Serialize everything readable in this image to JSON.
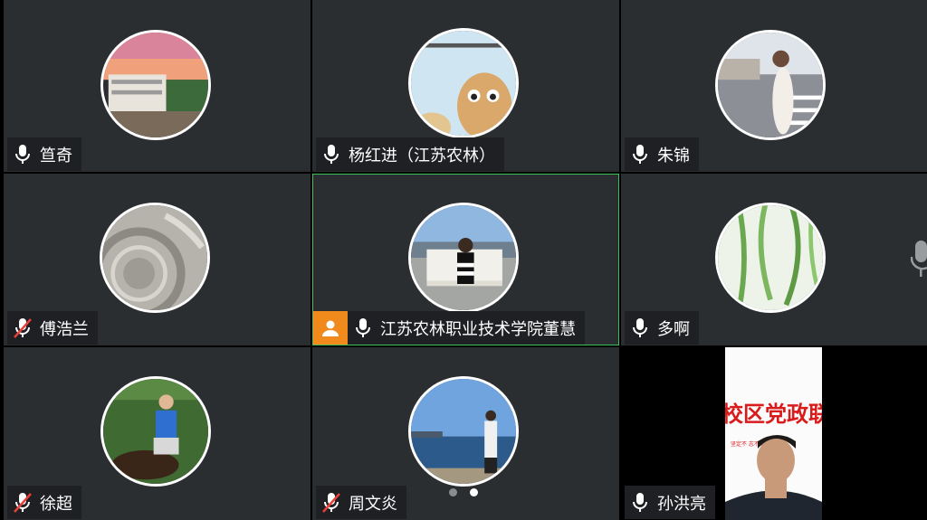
{
  "participants": [
    {
      "name": "笪奇",
      "mic": "on"
    },
    {
      "name": "杨红进（江苏农林）",
      "mic": "on"
    },
    {
      "name": "朱锦",
      "mic": "on"
    },
    {
      "name": "傅浩兰",
      "mic": "muted"
    },
    {
      "name": "江苏农林职业技术学院董慧",
      "mic": "on",
      "host": true,
      "active_speaker": true
    },
    {
      "name": "多啊",
      "mic": "on"
    },
    {
      "name": "徐超",
      "mic": "muted"
    },
    {
      "name": "周文炎",
      "mic": "muted"
    },
    {
      "name": "孙洪亮",
      "mic": "on",
      "video": true
    }
  ],
  "video_banner": {
    "headline": "校区党政联",
    "subline": "坚定不 志不渝新"
  },
  "pagination": {
    "pages": 2,
    "current": 2
  },
  "colors": {
    "active_border": "#3fc25c",
    "host_badge": "#f08a1c",
    "tile_bg": "#2b2e31"
  }
}
